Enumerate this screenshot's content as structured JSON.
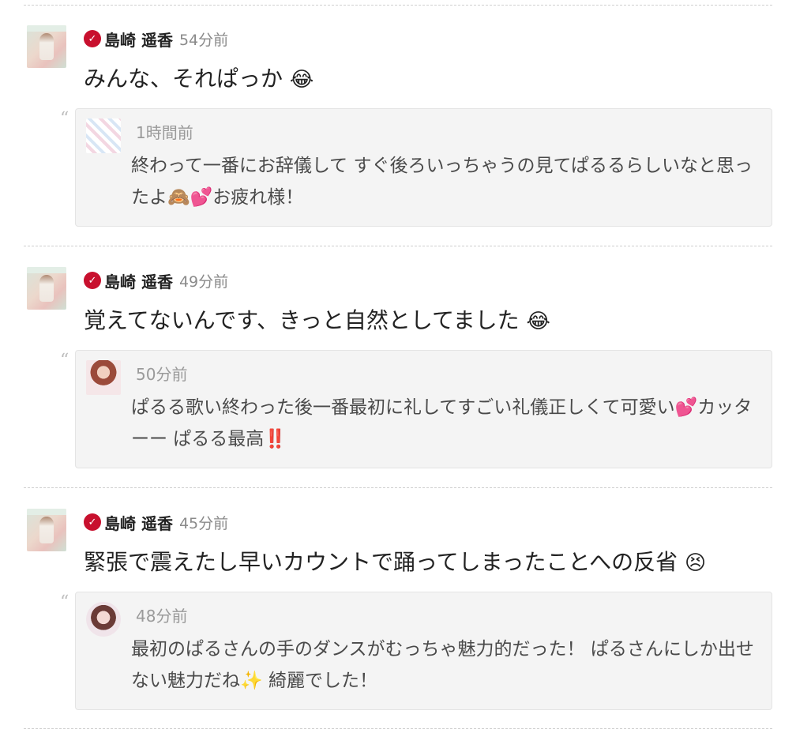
{
  "posts": [
    {
      "author": "島崎 遥香",
      "verified_icon": "check-badge-icon",
      "time": "54分前",
      "message": "みんな、それぱっか",
      "message_emoji": "😂",
      "reply": {
        "time": "1時間前",
        "text": "終わって一番にお辞儀して すぐ後ろいっちゃうの見てぱるるらしいなと思ったよ🙈💕お疲れ様！"
      }
    },
    {
      "author": "島崎 遥香",
      "verified_icon": "check-badge-icon",
      "time": "49分前",
      "message": "覚えてないんです、きっと自然としてました",
      "message_emoji": "😂",
      "reply": {
        "time": "50分前",
        "text": "ぱるる歌い終わった後一番最初に礼してすごい礼儀正しくて可愛い💕カッターー ぱるる最高‼️"
      }
    },
    {
      "author": "島崎 遥香",
      "verified_icon": "check-badge-icon",
      "time": "45分前",
      "message": "緊張で震えたし早いカウントで踊ってしまったことへの反省",
      "message_emoji": "😣",
      "reply": {
        "time": "48分前",
        "text": "最初のぱるさんの手のダンスがむっちゃ魅力的だった！ ぱるさんにしか出せない魅力だね✨ 綺麗でした！"
      }
    }
  ],
  "colors": {
    "badge": "#c8102e",
    "reply_bg": "#f4f4f4",
    "time": "#8a8a8a"
  }
}
